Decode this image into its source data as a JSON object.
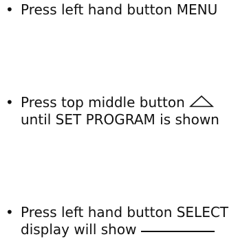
{
  "instructions": [
    {
      "bullet": "•",
      "lines": [
        "Press left hand button MENU"
      ]
    },
    {
      "bullet": "•",
      "lines": [
        "Press top middle button",
        "until SET PROGRAM is shown"
      ],
      "icon": "up-triangle-icon"
    },
    {
      "bullet": "•",
      "lines": [
        "Press left hand button SELECT",
        "display will show"
      ],
      "trailing_blank": true
    }
  ]
}
